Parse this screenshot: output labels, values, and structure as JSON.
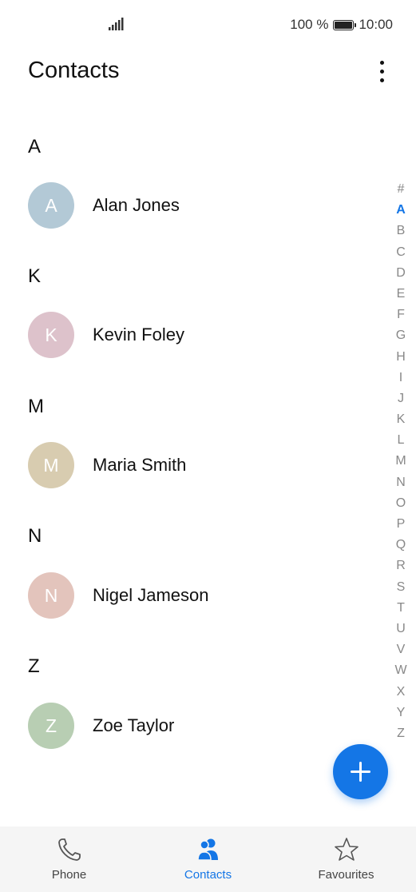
{
  "status_bar": {
    "battery": "100 %",
    "time": "10:00"
  },
  "header": {
    "title": "Contacts"
  },
  "contacts": [
    {
      "letter": "A",
      "initial": "A",
      "name": "Alan Jones",
      "color": "#b3c9d6"
    },
    {
      "letter": "K",
      "initial": "K",
      "name": "Kevin Foley",
      "color": "#ddc2cb"
    },
    {
      "letter": "M",
      "initial": "M",
      "name": "Maria Smith",
      "color": "#d8ccb0"
    },
    {
      "letter": "N",
      "initial": "N",
      "name": "Nigel Jameson",
      "color": "#e3c4bc"
    },
    {
      "letter": "Z",
      "initial": "Z",
      "name": "Zoe Taylor",
      "color": "#b8ceb3"
    }
  ],
  "alphabet_index": [
    "#",
    "A",
    "B",
    "C",
    "D",
    "E",
    "F",
    "G",
    "H",
    "I",
    "J",
    "K",
    "L",
    "M",
    "N",
    "O",
    "P",
    "Q",
    "R",
    "S",
    "T",
    "U",
    "V",
    "W",
    "X",
    "Y",
    "Z"
  ],
  "alphabet_active": "A",
  "bottom_nav": [
    {
      "label": "Phone",
      "icon": "phone-icon",
      "active": false
    },
    {
      "label": "Contacts",
      "icon": "contacts-icon",
      "active": true
    },
    {
      "label": "Favourites",
      "icon": "star-icon",
      "active": false
    }
  ],
  "colors": {
    "accent": "#1476e6"
  }
}
